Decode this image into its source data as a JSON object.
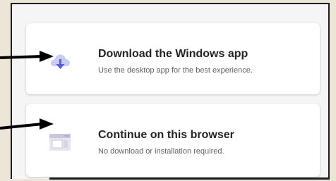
{
  "options": [
    {
      "title": "Download the Windows app",
      "subtitle": "Use the desktop app for the best experience.",
      "icon": "cloud-download-icon"
    },
    {
      "title": "Continue on this browser",
      "subtitle": "No download or installation required.",
      "icon": "browser-window-icon"
    }
  ],
  "colors": {
    "icon_accent": "#7b83eb",
    "icon_light": "#c7cbf5",
    "annotation_arrow": "#000000"
  }
}
